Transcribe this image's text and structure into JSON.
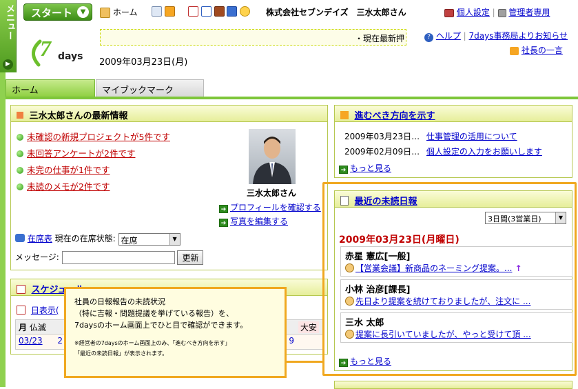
{
  "menu_tab": {
    "label": "メニュー"
  },
  "topbar": {
    "start": "スタート",
    "home": "ホーム",
    "company_user": "株式会社セブンデイズ　三水太郎さん",
    "personal_settings": "個人設定",
    "admin": "管理者専用"
  },
  "logo": {
    "number": "7",
    "word": "days"
  },
  "marquee": "・現在最新押",
  "date": "2009年03月23日(月)",
  "toplinks": {
    "help": "ヘルプ",
    "office_notice": "7days事務局よりお知らせ",
    "president": "社長の一言"
  },
  "tabs": [
    "ホーム",
    "マイブックマーク"
  ],
  "latest_info": {
    "title": "三水太郎さんの最新情報",
    "items": [
      "未確認の新規プロジェクトが5件です",
      "未回答アンケートが2件です",
      "未完の仕事が1件です",
      "未読のメモが2件です"
    ],
    "profile_name": "三水太郎さん",
    "profile_link": "プロフィールを確認する",
    "photo_link": "写真を編集する",
    "presence_link": "在席表",
    "presence_label": "現在の在席状態:",
    "presence_value": "在席",
    "message_label": "メッセージ:",
    "update_button": "更新"
  },
  "schedule": {
    "title": "スケジュール",
    "display_label": "日表示(",
    "col_day": "月",
    "col_rokuyo": "仏滅",
    "col_right": "大安",
    "date_cell": "03/23",
    "cut_cell": "2",
    "cut_right": "9"
  },
  "direction": {
    "title": "進むべき方向を示す",
    "rows": [
      {
        "date": "2009年03月23日…",
        "text": "仕事管理の活用について"
      },
      {
        "date": "2009年02月09日…",
        "text": "個人設定の入力をお願いします"
      }
    ],
    "more": "もっと見る"
  },
  "unread_reports": {
    "title": "最近の未読日報",
    "select_value": "3日間(3営業日)",
    "date_heading": "2009年03月23日(月曜日)",
    "entries": [
      {
        "name": "赤星 憲広[一般]",
        "text": "【営業会議】新商品のネーミング提案。..."
      },
      {
        "name": "小林 治彦[課長]",
        "text": "先日より提案を続けておりましたが、注文に ..."
      },
      {
        "name": "三水 太郎",
        "text": "提案に長引いていましたが、やっと受けて頂 ..."
      }
    ],
    "more": "もっと見る"
  },
  "callout": {
    "line1": "社員の日報報告の未読状況",
    "line2": "（特に吉報・問題提議を挙げている報告）を、",
    "line3": "7daysのホーム画面上でひと目で確認ができます。",
    "note1": "※経営者の7daysのホーム画面上のみ、「進むべき方向を示す」",
    "note2": "「最近の未読日報」が表示されます。"
  },
  "colors": {
    "accent_green": "#7ec63a",
    "highlight_orange": "#f0a820",
    "link_red": "#c00000",
    "link_blue": "#0000cc"
  }
}
